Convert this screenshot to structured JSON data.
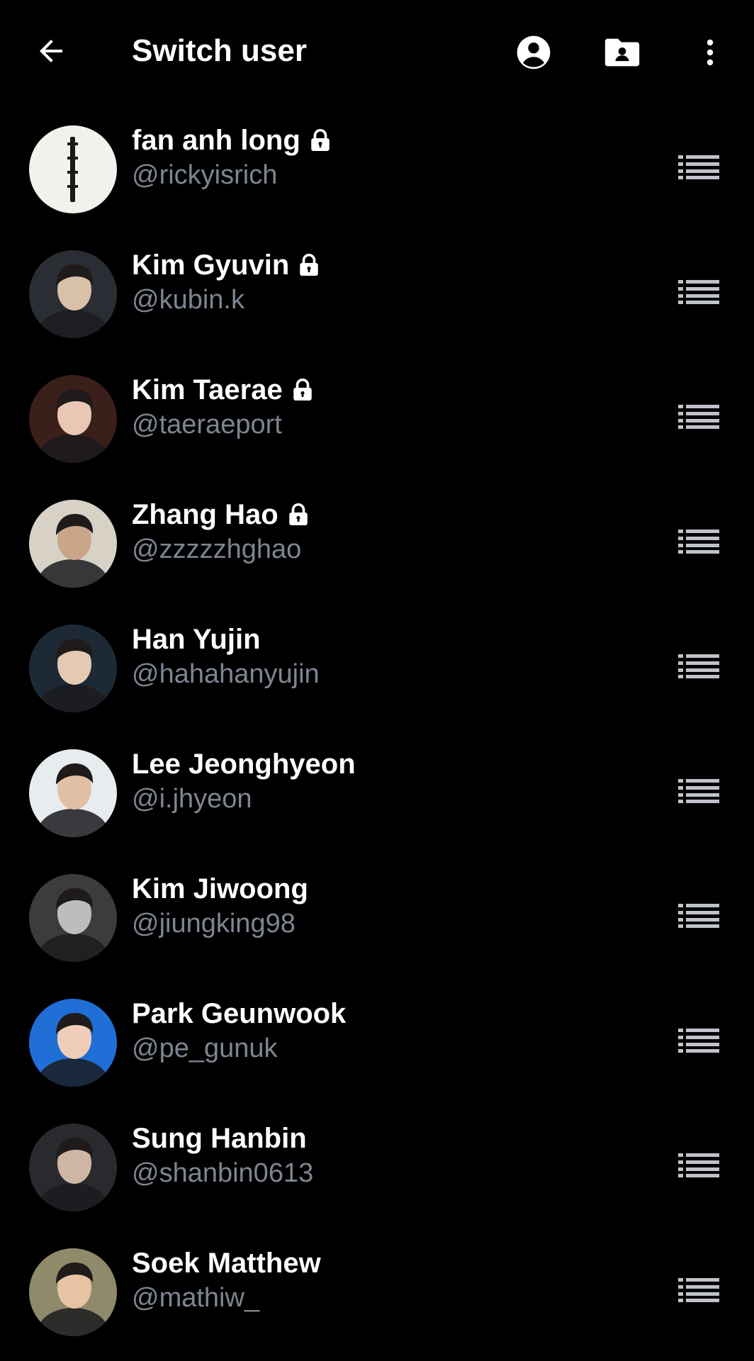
{
  "header": {
    "title": "Switch user",
    "icons": [
      "back-arrow-icon",
      "account-circle-icon",
      "folder-user-icon",
      "more-vert-icon"
    ]
  },
  "colors": {
    "background": "#000000",
    "name": "#ffffff",
    "handle": "#7e8591",
    "icon": "#ffffff",
    "list_icon": "#bfc3c9"
  },
  "users": [
    {
      "name": "fan anh long",
      "handle": "@rickyisrich",
      "locked": true,
      "avatar": {
        "bg": "#f3f1ec",
        "face": "#1a1a1a",
        "style": "text-logo"
      }
    },
    {
      "name": "Kim Gyuvin",
      "handle": "@kubin.k",
      "locked": true,
      "avatar": {
        "bg": "#2b2d35",
        "face": "#d9c0a8",
        "style": "photo"
      }
    },
    {
      "name": "Kim Taerae",
      "handle": "@taeraeport",
      "locked": true,
      "avatar": {
        "bg": "#3a1f1a",
        "face": "#e8c7b5",
        "style": "photo"
      }
    },
    {
      "name": "Zhang Hao",
      "handle": "@zzzzzhghao",
      "locked": true,
      "avatar": {
        "bg": "#d8d2c6",
        "face": "#c9a58a",
        "style": "photo"
      }
    },
    {
      "name": "Han Yujin",
      "handle": "@hahahanyujin",
      "locked": false,
      "avatar": {
        "bg": "#1d2a36",
        "face": "#e5c9b3",
        "style": "photo"
      }
    },
    {
      "name": "Lee Jeonghyeon",
      "handle": "@i.jhyeon",
      "locked": false,
      "avatar": {
        "bg": "#e7ecef",
        "face": "#e0bfa5",
        "style": "photo"
      }
    },
    {
      "name": "Kim Jiwoong",
      "handle": "@jiungking98",
      "locked": false,
      "avatar": {
        "bg": "#3c3c3c",
        "face": "#bdbdbd",
        "style": "photo"
      }
    },
    {
      "name": "Park Geunwook",
      "handle": "@pe_gunuk",
      "locked": false,
      "avatar": {
        "bg": "#1f6fd6",
        "face": "#f0cdb9",
        "style": "photo"
      }
    },
    {
      "name": "Sung Hanbin",
      "handle": "@shanbin0613",
      "locked": false,
      "avatar": {
        "bg": "#2a2a2e",
        "face": "#cfb6a4",
        "style": "photo"
      }
    },
    {
      "name": "Soek Matthew",
      "handle": "@mathiw_",
      "locked": false,
      "avatar": {
        "bg": "#8f8a6a",
        "face": "#e8c3a3",
        "style": "photo"
      }
    }
  ]
}
